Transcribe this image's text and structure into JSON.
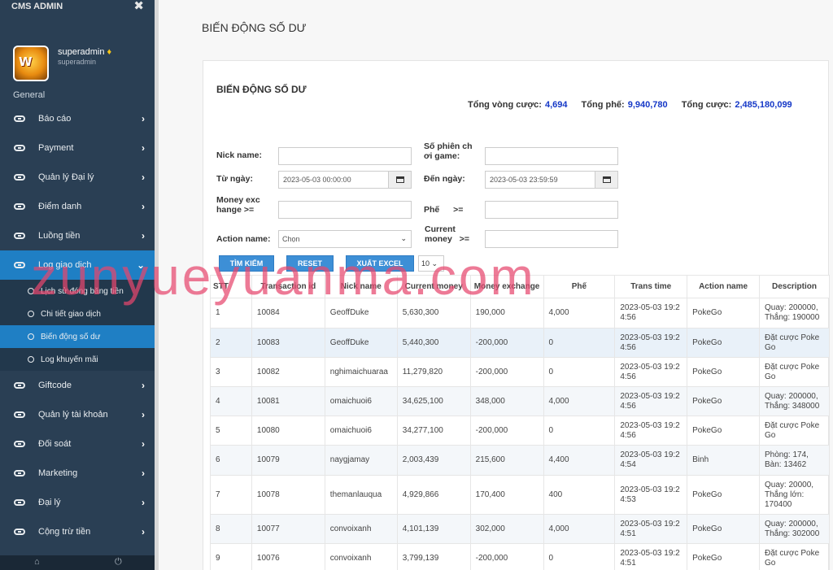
{
  "app": {
    "brand": "CMS ADMIN"
  },
  "profile": {
    "name": "superadmin",
    "role": "superadmin"
  },
  "sidebar": {
    "section": "General",
    "items": [
      {
        "label": "Báo cáo"
      },
      {
        "label": "Payment"
      },
      {
        "label": "Quản lý Đại lý"
      },
      {
        "label": "Điểm danh"
      },
      {
        "label": "Luồng tiền"
      },
      {
        "label": "Log giao dịch"
      }
    ],
    "sub_items": [
      {
        "label": "Lịch sử đóng băng tiền"
      },
      {
        "label": "Chi tiết giao dịch"
      },
      {
        "label": "Biến động số dư"
      },
      {
        "label": "Log khuyến mãi"
      }
    ],
    "items_after": [
      {
        "label": "Giftcode"
      },
      {
        "label": "Quản lý tài khoản"
      },
      {
        "label": "Đối soát"
      },
      {
        "label": "Marketing"
      },
      {
        "label": "Đại lý"
      },
      {
        "label": "Cộng trừ tiền"
      }
    ]
  },
  "page": {
    "title": "BIẾN ĐỘNG SỐ DƯ",
    "panel_title": "BIẾN ĐỘNG SỐ DƯ"
  },
  "totals": {
    "vong_cuoc_label": "Tổng vòng cược:",
    "vong_cuoc": "4,694",
    "phe_label": "Tổng phế:",
    "phe": "9,940,780",
    "cuoc_label": "Tổng cược:",
    "cuoc": "2,485,180,099"
  },
  "filters": {
    "nick_label": "Nick name:",
    "session_label": "Số phiên ch ơi game:",
    "from_label": "Từ ngày:",
    "from_value": "2023-05-03 00:00:00",
    "to_label": "Đến ngày:",
    "to_value": "2023-05-03 23:59:59",
    "money_exchange_label": "Money exc hange >=",
    "phe_label": "Phế >=",
    "action_label": "Action name:",
    "action_value": "Chọn",
    "current_money_label": "Current money >="
  },
  "buttons": {
    "search": "TÌM KIẾM",
    "reset": "RESET",
    "export": "XUẤT EXCEL",
    "page_size": "10"
  },
  "table": {
    "headers": [
      "STT",
      "Transaction id",
      "Nick name",
      "Current money",
      "Money exchange",
      "Phế",
      "Trans time",
      "Action name",
      "Description"
    ],
    "rows": [
      [
        "1",
        "10084",
        "GeoffDuke",
        "5,630,300",
        "190,000",
        "4,000",
        "2023-05-03 19:2 4:56",
        "PokeGo",
        "Quay: 200000, Thắng: 190000"
      ],
      [
        "2",
        "10083",
        "GeoffDuke",
        "5,440,300",
        "-200,000",
        "0",
        "2023-05-03 19:2 4:56",
        "PokeGo",
        "Đặt cược Poke Go"
      ],
      [
        "3",
        "10082",
        "nghimaichuaraa",
        "11,279,820",
        "-200,000",
        "0",
        "2023-05-03 19:2 4:56",
        "PokeGo",
        "Đặt cược Poke Go"
      ],
      [
        "4",
        "10081",
        "omaichuoi6",
        "34,625,100",
        "348,000",
        "4,000",
        "2023-05-03 19:2 4:56",
        "PokeGo",
        "Quay: 200000, Thắng: 348000"
      ],
      [
        "5",
        "10080",
        "omaichuoi6",
        "34,277,100",
        "-200,000",
        "0",
        "2023-05-03 19:2 4:56",
        "PokeGo",
        "Đặt cược Poke Go"
      ],
      [
        "6",
        "10079",
        "naygjamay",
        "2,003,439",
        "215,600",
        "4,400",
        "2023-05-03 19:2 4:54",
        "Binh",
        "Phòng: 174, Bàn: 13462"
      ],
      [
        "7",
        "10078",
        "themanlauqua",
        "4,929,866",
        "170,400",
        "400",
        "2023-05-03 19:2 4:53",
        "PokeGo",
        "Quay: 20000, Thắng lớn: 170400"
      ],
      [
        "8",
        "10077",
        "convoixanh",
        "4,101,139",
        "302,000",
        "4,000",
        "2023-05-03 19:2 4:51",
        "PokeGo",
        "Quay: 200000, Thắng: 302000"
      ],
      [
        "9",
        "10076",
        "convoixanh",
        "3,799,139",
        "-200,000",
        "0",
        "2023-05-03 19:2 4:51",
        "PokeGo",
        "Đặt cược Poke Go"
      ]
    ]
  },
  "watermark": "zunyueyuanma.com"
}
